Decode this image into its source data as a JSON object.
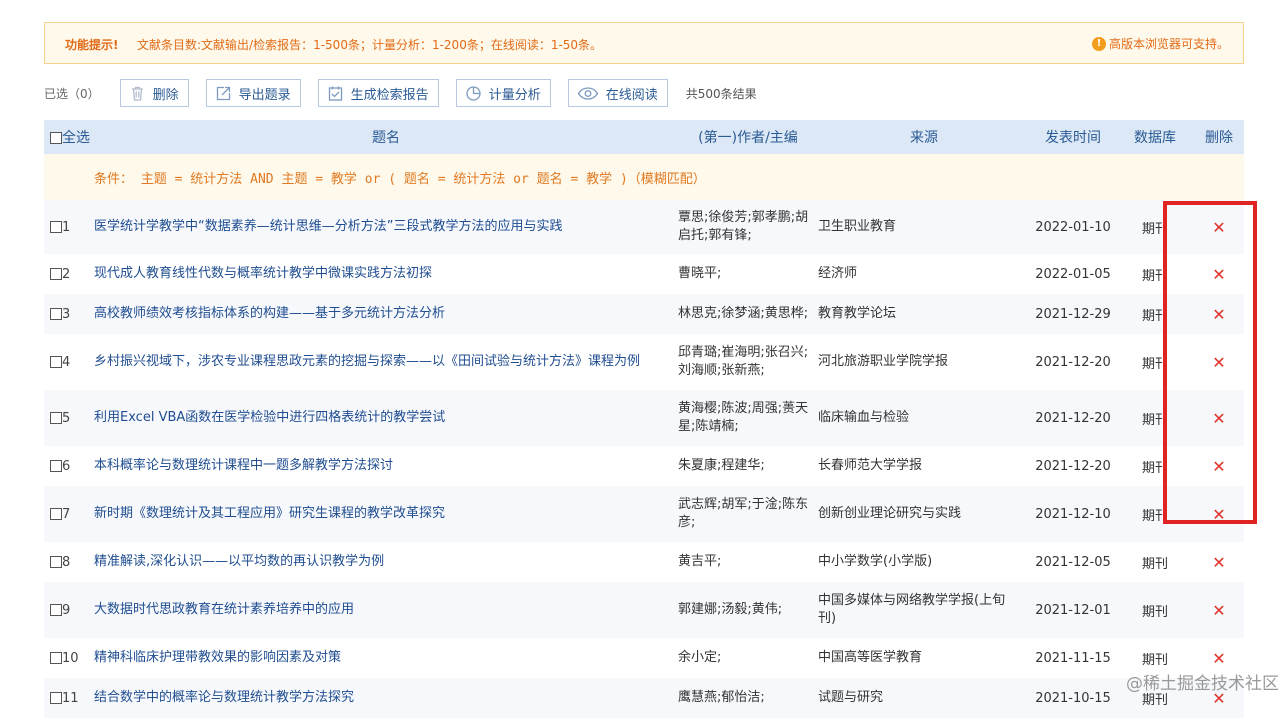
{
  "notice": {
    "label": "功能提示!",
    "text": "文献条目数:文献输出/检索报告：1-500条；计量分析：1-200条；在线阅读：1-50条。",
    "right_text": "高版本浏览器可支持。"
  },
  "toolbar": {
    "selected": "已选（0）",
    "delete": "删除",
    "export": "导出题录",
    "report": "生成检索报告",
    "analysis": "计量分析",
    "read": "在线阅读",
    "total": "共500条结果"
  },
  "table": {
    "headers": {
      "select_all": "全选",
      "title": "题名",
      "author": "(第一)作者/主编",
      "source": "来源",
      "date": "发表时间",
      "db": "数据库",
      "del": "删除"
    },
    "condition": "条件： 主题 = 统计方法 AND 主题 = 教学 or ( 题名 = 统计方法 or 题名 = 教学 )（模糊匹配）",
    "rows": [
      {
        "n": "1",
        "title": "医学统计学教学中“数据素养—统计思维—分析方法”三段式教学方法的应用与实践",
        "author": "覃思;徐俊芳;郭孝鹏;胡启托;郭有锋;",
        "source": "卫生职业教育",
        "date": "2022-01-10",
        "db": "期刊"
      },
      {
        "n": "2",
        "title": "现代成人教育线性代数与概率统计教学中微课实践方法初探",
        "author": "曹晓平;",
        "source": "经济师",
        "date": "2022-01-05",
        "db": "期刊"
      },
      {
        "n": "3",
        "title": "高校教师绩效考核指标体系的构建——基于多元统计方法分析",
        "author": "林思克;徐梦涵;黄思桦;",
        "source": "教育教学论坛",
        "date": "2021-12-29",
        "db": "期刊"
      },
      {
        "n": "4",
        "title": "乡村振兴视域下，涉农专业课程思政元素的挖掘与探索——以《田间试验与统计方法》课程为例",
        "author": "邱青璐;崔海明;张召兴;刘海顺;张新燕;",
        "source": "河北旅游职业学院学报",
        "date": "2021-12-20",
        "db": "期刊"
      },
      {
        "n": "5",
        "title": "利用Excel VBA函数在医学检验中进行四格表统计的教学尝试",
        "author": "黄海樱;陈波;周强;蒉天星;陈靖楠;",
        "source": "临床输血与检验",
        "date": "2021-12-20",
        "db": "期刊"
      },
      {
        "n": "6",
        "title": "本科概率论与数理统计课程中一题多解教学方法探讨",
        "author": "朱夏康;程建华;",
        "source": "长春师范大学学报",
        "date": "2021-12-20",
        "db": "期刊"
      },
      {
        "n": "7",
        "title": "新时期《数理统计及其工程应用》研究生课程的教学改革探究",
        "author": "武志辉;胡军;于淦;陈东彦;",
        "source": "创新创业理论研究与实践",
        "date": "2021-12-10",
        "db": "期刊"
      },
      {
        "n": "8",
        "title": "精准解读,深化认识——以平均数的再认识教学为例",
        "author": "黄吉平;",
        "source": "中小学数学(小学版)",
        "date": "2021-12-05",
        "db": "期刊"
      },
      {
        "n": "9",
        "title": "大数据时代思政教育在统计素养培养中的应用",
        "author": "郭建娜;汤毅;黄伟;",
        "source": "中国多媒体与网络教学学报(上旬刊)",
        "date": "2021-12-01",
        "db": "期刊"
      },
      {
        "n": "10",
        "title": "精神科临床护理带教效果的影响因素及对策",
        "author": "余小定;",
        "source": "中国高等医学教育",
        "date": "2021-11-15",
        "db": "期刊"
      },
      {
        "n": "11",
        "title": "结合数学中的概率论与数理统计教学方法探究",
        "author": "鹰慧燕;郁怡洁;",
        "source": "试题与研究",
        "date": "2021-10-15",
        "db": "期刊"
      }
    ]
  },
  "watermark": "@稀土掘金技术社区",
  "colors": {
    "accent": "#2b5b94",
    "notice": "#e26b17",
    "delete_x": "#e0302a",
    "highlight_box": "#e02424"
  }
}
